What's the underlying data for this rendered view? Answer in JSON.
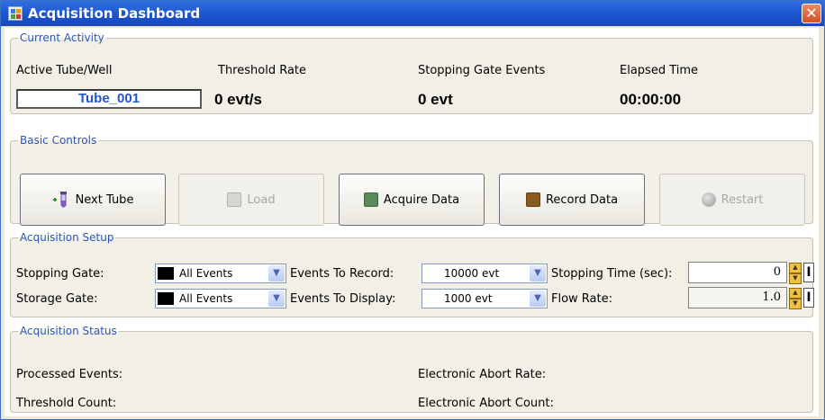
{
  "window": {
    "title": "Acquisition Dashboard",
    "close_glyph": "✕"
  },
  "current_activity": {
    "legend": "Current Activity",
    "active_tube_label": "Active Tube/Well",
    "active_tube_value": "Tube_001",
    "threshold_rate_label": "Threshold Rate",
    "threshold_rate_value": "0 evt/s",
    "stopping_gate_events_label": "Stopping Gate Events",
    "stopping_gate_events_value": "0 evt",
    "elapsed_time_label": "Elapsed Time",
    "elapsed_time_value": "00:00:00"
  },
  "basic_controls": {
    "legend": "Basic Controls",
    "buttons": [
      {
        "label": "Next Tube",
        "icon": "tube-icon",
        "enabled": true
      },
      {
        "label": "Load",
        "icon": "load-icon",
        "enabled": false
      },
      {
        "label": "Acquire Data",
        "icon": "acquire-icon",
        "color": "#5a8a5a",
        "enabled": true
      },
      {
        "label": "Record Data",
        "icon": "record-icon",
        "color": "#8a5a20",
        "enabled": true
      },
      {
        "label": "Restart",
        "icon": "restart-icon",
        "enabled": false
      }
    ]
  },
  "acquisition_setup": {
    "legend": "Acquisition Setup",
    "stopping_gate_label": "Stopping Gate:",
    "stopping_gate_value": "All Events",
    "storage_gate_label": "Storage Gate:",
    "storage_gate_value": "All Events",
    "events_to_record_label": "Events To Record:",
    "events_to_record_value": "10000 evt",
    "events_to_display_label": "Events To Display:",
    "events_to_display_value": "1000 evt",
    "stopping_time_label": "Stopping Time (sec):",
    "stopping_time_value": "0",
    "flow_rate_label": "Flow Rate:",
    "flow_rate_value": "1.0"
  },
  "acquisition_status": {
    "legend": "Acquisition Status",
    "processed_events_label": "Processed Events:",
    "threshold_count_label": "Threshold Count:",
    "electronic_abort_rate_label": "Electronic Abort Rate:",
    "electronic_abort_count_label": "Electronic Abort Count:"
  },
  "colors": {
    "title_bar": "#1d55cf",
    "legend_text": "#2b56b8",
    "group_bg": "#f1efe6",
    "tube_value_text": "#2355c8"
  }
}
